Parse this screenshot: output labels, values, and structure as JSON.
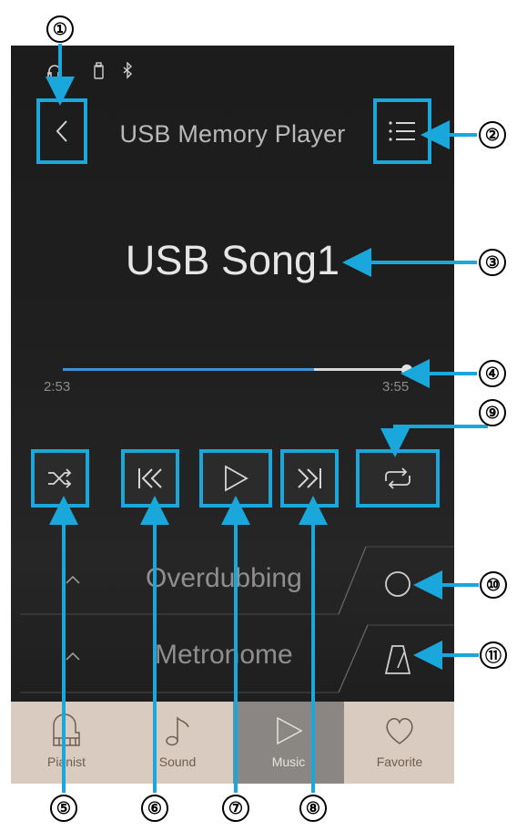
{
  "header": {
    "title": "USB Memory Player",
    "back_icon": "chevron-left-icon",
    "menu_icon": "list-icon"
  },
  "status_bar": {
    "icons": [
      "headphones-icon",
      "usb-icon",
      "bluetooth-icon"
    ]
  },
  "song": {
    "title": "USB Song1"
  },
  "progress": {
    "elapsed": "2:53",
    "total": "3:55",
    "fraction": 0.73
  },
  "controls": [
    {
      "name": "shuffle-icon"
    },
    {
      "name": "previous-icon"
    },
    {
      "name": "play-icon"
    },
    {
      "name": "next-icon"
    },
    {
      "name": "repeat-icon"
    }
  ],
  "rows": {
    "overdubbing": "Overdubbing",
    "metronome": "Metronome"
  },
  "bottom_nav": {
    "items": [
      {
        "label": "Pianist",
        "icon": "piano-icon"
      },
      {
        "label": "Sound",
        "icon": "note-icon"
      },
      {
        "label": "Music",
        "icon": "play-outline-icon"
      },
      {
        "label": "Favorite",
        "icon": "heart-icon"
      }
    ],
    "active": "Music"
  },
  "callouts": [
    "①",
    "②",
    "③",
    "④",
    "⑤",
    "⑥",
    "⑦",
    "⑧",
    "⑨",
    "⑩",
    "⑪"
  ],
  "colors": {
    "highlight": "#1aa7dc",
    "progress": "#3d8fd6",
    "nav_bg": "#d9cbc0",
    "nav_active": "#8a8683"
  }
}
